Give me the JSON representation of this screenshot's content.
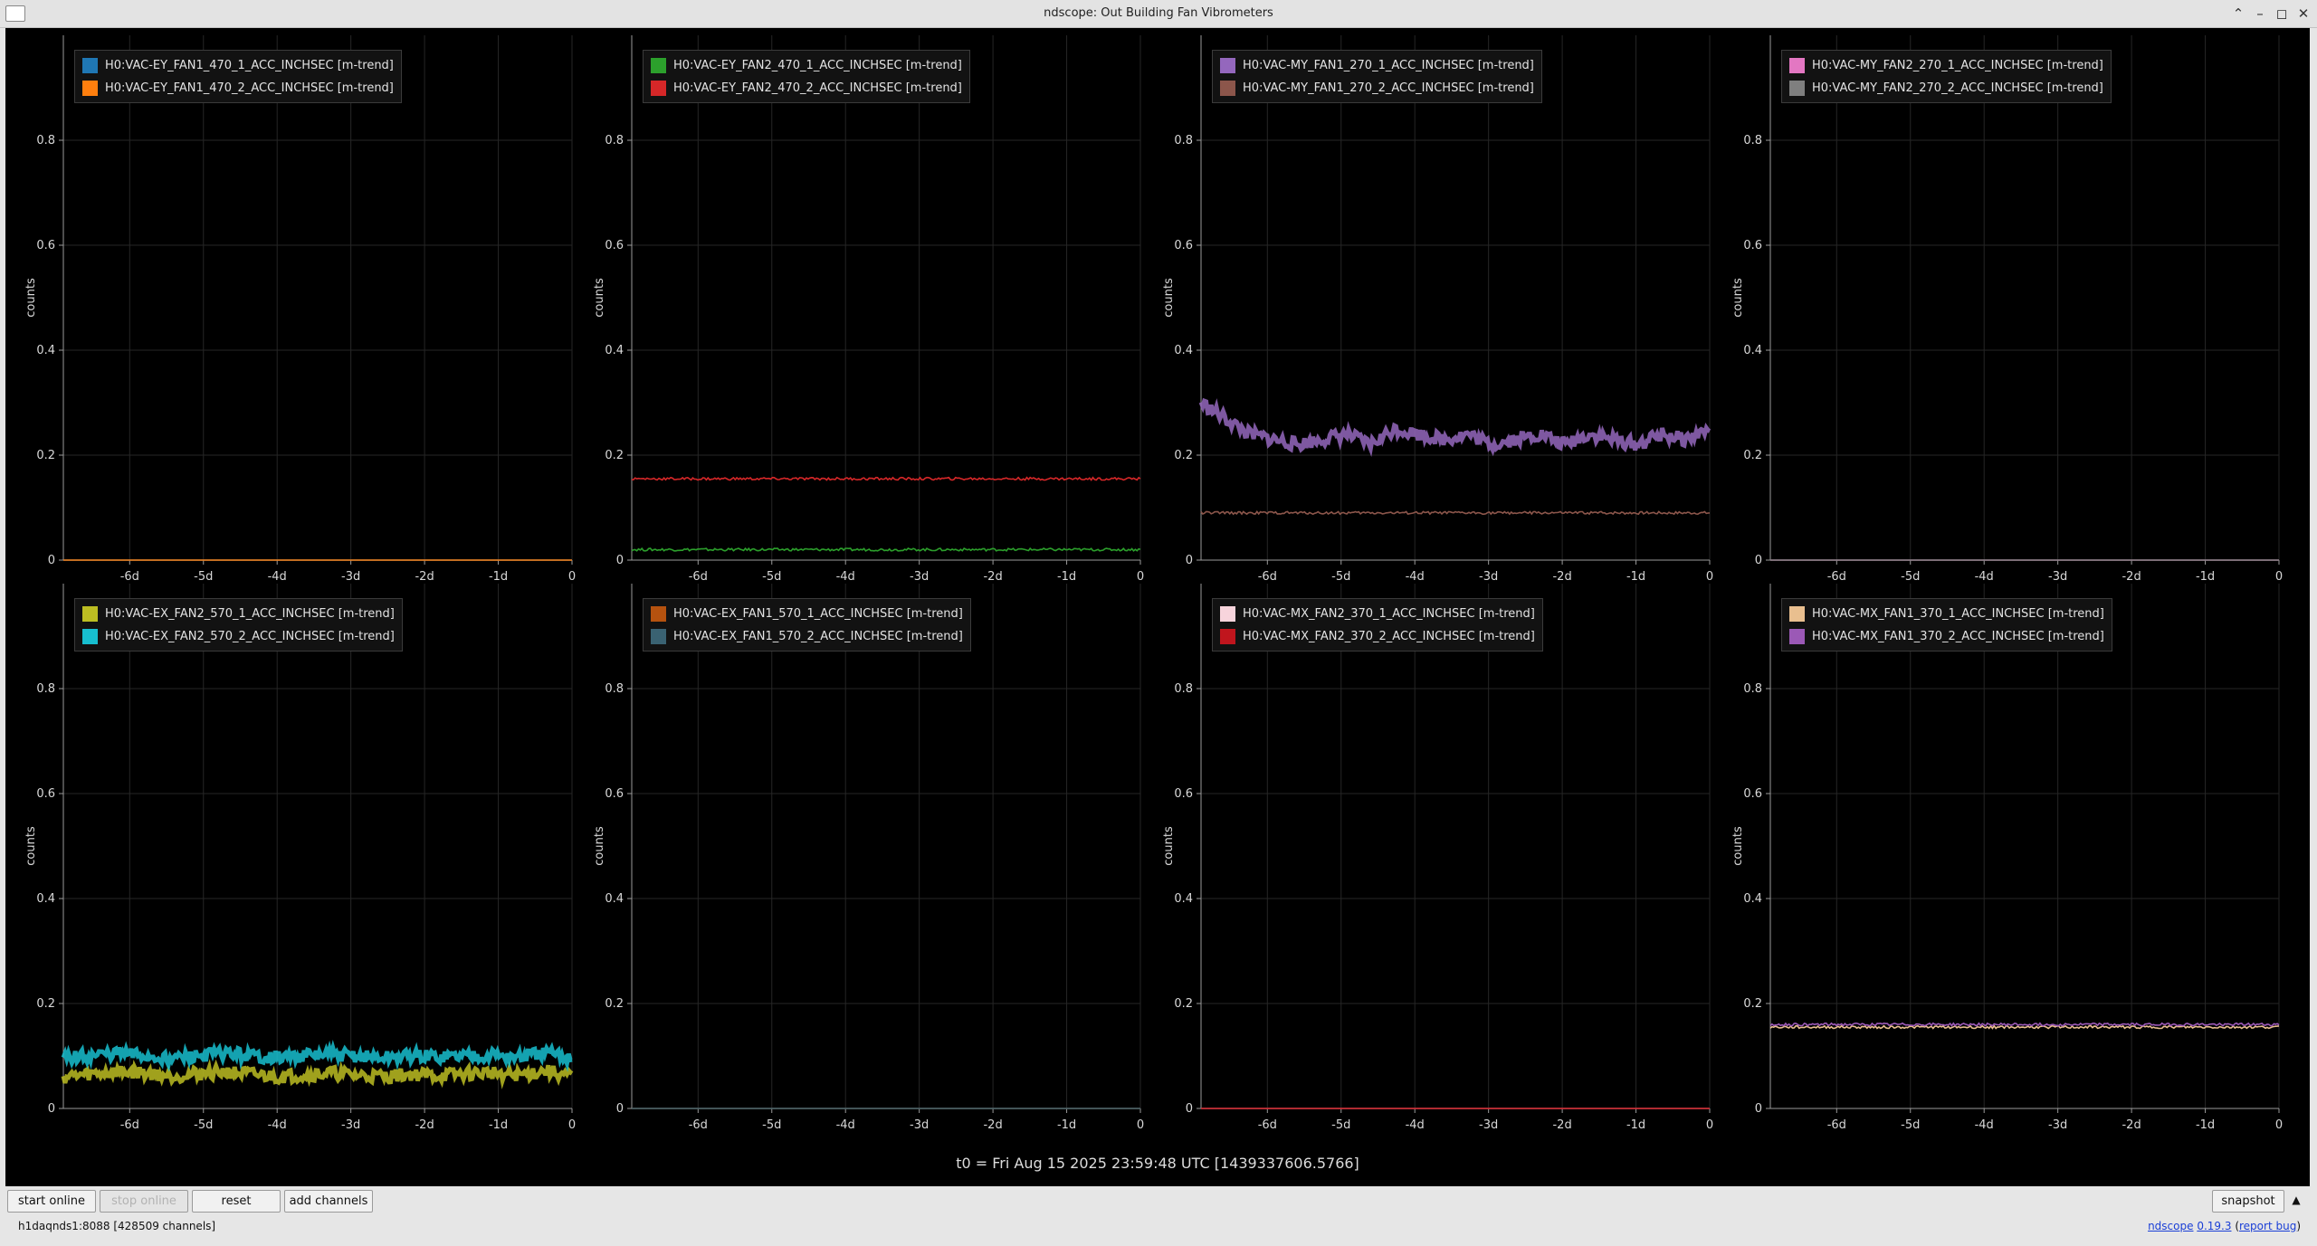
{
  "window": {
    "title": "ndscope: Out Building Fan Vibrometers"
  },
  "t0_label": "t0 = Fri Aug 15 2025 23:59:48 UTC [1439337606.5766]",
  "xticks": [
    "-6d",
    "-5d",
    "-4d",
    "-3d",
    "-2d",
    "-1d",
    "0"
  ],
  "yticks": [
    "0",
    "0.2",
    "0.4",
    "0.6",
    "0.8"
  ],
  "ylabel": "counts",
  "colors": {
    "plot_bg": "#000000",
    "grid": "#262626",
    "axis": "#9a9a9a",
    "tick_text": "#d8d8d8"
  },
  "chart_data": [
    {
      "type": "line",
      "ylabel": "counts",
      "xlim": [
        -6.9,
        0
      ],
      "ylim": [
        0,
        1
      ],
      "series": [
        {
          "name": "H0:VAC-EY_FAN1_470_1_ACC_INCHSEC [m-trend]",
          "color": "#1f77b4",
          "values": [
            0.0
          ]
        },
        {
          "name": "H0:VAC-EY_FAN1_470_2_ACC_INCHSEC [m-trend]",
          "color": "#ff7f0e",
          "values": [
            0.0
          ]
        }
      ]
    },
    {
      "type": "line",
      "ylabel": "counts",
      "xlim": [
        -6.9,
        0
      ],
      "ylim": [
        0,
        1
      ],
      "series": [
        {
          "name": "H0:VAC-EY_FAN2_470_1_ACC_INCHSEC [m-trend]",
          "color": "#2ca02c",
          "values": [
            0.02
          ]
        },
        {
          "name": "H0:VAC-EY_FAN2_470_2_ACC_INCHSEC [m-trend]",
          "color": "#d62728",
          "values": [
            0.155
          ]
        }
      ]
    },
    {
      "type": "line",
      "ylabel": "counts",
      "xlim": [
        -6.9,
        0
      ],
      "ylim": [
        0,
        1
      ],
      "series": [
        {
          "name": "H0:VAC-MY_FAN1_270_1_ACC_INCHSEC [m-trend]",
          "color": "#9467bd",
          "values": [
            0.3,
            0.27,
            0.24,
            0.23,
            0.22,
            0.23,
            0.24,
            0.22,
            0.25,
            0.24,
            0.23,
            0.24,
            0.22,
            0.23,
            0.24,
            0.22,
            0.24,
            0.23,
            0.22,
            0.24,
            0.23,
            0.25
          ]
        },
        {
          "name": "H0:VAC-MY_FAN1_270_2_ACC_INCHSEC [m-trend]",
          "color": "#8c564b",
          "values": [
            0.09
          ]
        }
      ]
    },
    {
      "type": "line",
      "ylabel": "counts",
      "xlim": [
        -6.9,
        0
      ],
      "ylim": [
        0,
        1
      ],
      "series": [
        {
          "name": "H0:VAC-MY_FAN2_270_1_ACC_INCHSEC [m-trend]",
          "color": "#e377c2",
          "values": [
            0.0
          ]
        },
        {
          "name": "H0:VAC-MY_FAN2_270_2_ACC_INCHSEC [m-trend]",
          "color": "#7f7f7f",
          "values": [
            0.0
          ]
        }
      ]
    },
    {
      "type": "line",
      "ylabel": "counts",
      "xlim": [
        -6.9,
        0
      ],
      "ylim": [
        0,
        1
      ],
      "series": [
        {
          "name": "H0:VAC-EX_FAN2_570_1_ACC_INCHSEC [m-trend]",
          "color": "#bcbd22",
          "values": [
            0.06,
            0.065,
            0.07,
            0.068,
            0.062,
            0.066,
            0.07,
            0.065,
            0.06,
            0.064,
            0.067,
            0.063,
            0.061,
            0.065,
            0.062,
            0.066,
            0.068,
            0.063,
            0.072,
            0.06
          ]
        },
        {
          "name": "H0:VAC-EX_FAN2_570_2_ACC_INCHSEC [m-trend]",
          "color": "#17becf",
          "values": [
            0.095,
            0.1,
            0.105,
            0.1,
            0.095,
            0.1,
            0.105,
            0.1,
            0.097,
            0.1,
            0.103,
            0.099,
            0.096,
            0.1,
            0.098,
            0.101,
            0.102,
            0.097,
            0.105,
            0.095
          ]
        }
      ]
    },
    {
      "type": "line",
      "ylabel": "counts",
      "xlim": [
        -6.9,
        0
      ],
      "ylim": [
        0,
        1
      ],
      "series": [
        {
          "name": "H0:VAC-EX_FAN1_570_1_ACC_INCHSEC [m-trend]",
          "color": "#b5520f",
          "values": [
            0.0
          ]
        },
        {
          "name": "H0:VAC-EX_FAN1_570_2_ACC_INCHSEC [m-trend]",
          "color": "#3a6272",
          "values": [
            0.0
          ]
        }
      ]
    },
    {
      "type": "line",
      "ylabel": "counts",
      "xlim": [
        -6.9,
        0
      ],
      "ylim": [
        0,
        1
      ],
      "series": [
        {
          "name": "H0:VAC-MX_FAN2_370_1_ACC_INCHSEC [m-trend]",
          "color": "#f7d4dc",
          "values": [
            0.0
          ]
        },
        {
          "name": "H0:VAC-MX_FAN2_370_2_ACC_INCHSEC [m-trend]",
          "color": "#c0151d",
          "values": [
            0.0
          ]
        }
      ]
    },
    {
      "type": "line",
      "ylabel": "counts",
      "xlim": [
        -6.9,
        0
      ],
      "ylim": [
        0,
        1
      ],
      "series": [
        {
          "name": "H0:VAC-MX_FAN1_370_1_ACC_INCHSEC [m-trend]",
          "color": "#e9bf8f",
          "values": [
            0.155
          ]
        },
        {
          "name": "H0:VAC-MX_FAN1_370_2_ACC_INCHSEC [m-trend]",
          "color": "#9b59b6",
          "values": [
            0.16
          ]
        }
      ]
    }
  ],
  "controls": {
    "start_online": "start online",
    "stop_online": "stop online",
    "reset": "reset",
    "add_channels": "add channels",
    "snapshot": "snapshot"
  },
  "status": {
    "server": "h1daqnds1:8088",
    "channels": "[428509 channels]"
  },
  "footer": {
    "app": "ndscope",
    "version": "0.19.3",
    "report_open": "(",
    "report": "report bug",
    "report_close": ")"
  }
}
